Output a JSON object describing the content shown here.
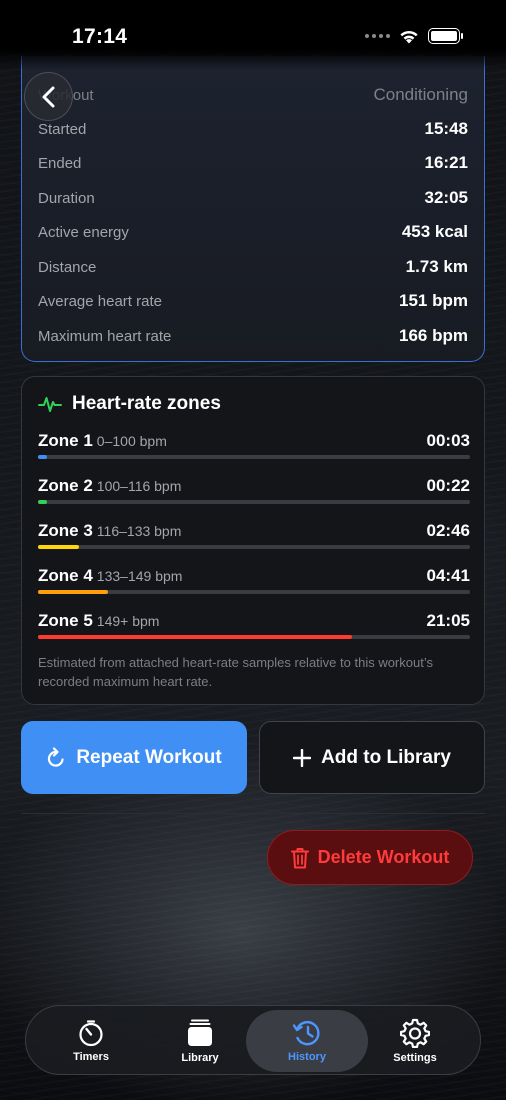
{
  "status_bar": {
    "time": "17:14"
  },
  "summary": {
    "rows": [
      {
        "label": "Workout",
        "value": "Conditioning"
      },
      {
        "label": "Started",
        "value": "15:48"
      },
      {
        "label": "Ended",
        "value": "16:21"
      },
      {
        "label": "Duration",
        "value": "32:05"
      },
      {
        "label": "Active energy",
        "value": "453 kcal"
      },
      {
        "label": "Distance",
        "value": "1.73 km"
      },
      {
        "label": "Average heart rate",
        "value": "151 bpm"
      },
      {
        "label": "Maximum heart rate",
        "value": "166 bpm"
      }
    ]
  },
  "zones": {
    "title": "Heart-rate zones",
    "items": [
      {
        "name": "Zone 1",
        "range": "0–100 bpm",
        "time": "00:03",
        "fraction": 0.02,
        "color": "#3f8ff5"
      },
      {
        "name": "Zone 2",
        "range": "100–116 bpm",
        "time": "00:22",
        "fraction": 0.02,
        "color": "#30d158"
      },
      {
        "name": "Zone 3",
        "range": "116–133 bpm",
        "time": "02:46",
        "fraction": 0.095,
        "color": "#ffd60a"
      },
      {
        "name": "Zone 4",
        "range": "133–149 bpm",
        "time": "04:41",
        "fraction": 0.162,
        "color": "#ff9f0a"
      },
      {
        "name": "Zone 5",
        "range": "149+ bpm",
        "time": "21:05",
        "fraction": 0.727,
        "color": "#ff3b30"
      }
    ],
    "note": "Estimated from attached heart-rate samples relative to this workout’s recorded maximum heart rate."
  },
  "actions": {
    "repeat_label": "Repeat Workout",
    "library_label": "Add to Library",
    "delete_label": "Delete Workout"
  },
  "tab_bar": {
    "tabs": [
      {
        "label": "Timers",
        "icon": "stopwatch-icon"
      },
      {
        "label": "Library",
        "icon": "stack-icon"
      },
      {
        "label": "History",
        "icon": "history-icon",
        "active": true
      },
      {
        "label": "Settings",
        "icon": "gear-icon"
      }
    ]
  },
  "colors": {
    "accent": "#3f8ff5",
    "danger": "#ff3b30",
    "active_tab": "#4d96ff"
  }
}
